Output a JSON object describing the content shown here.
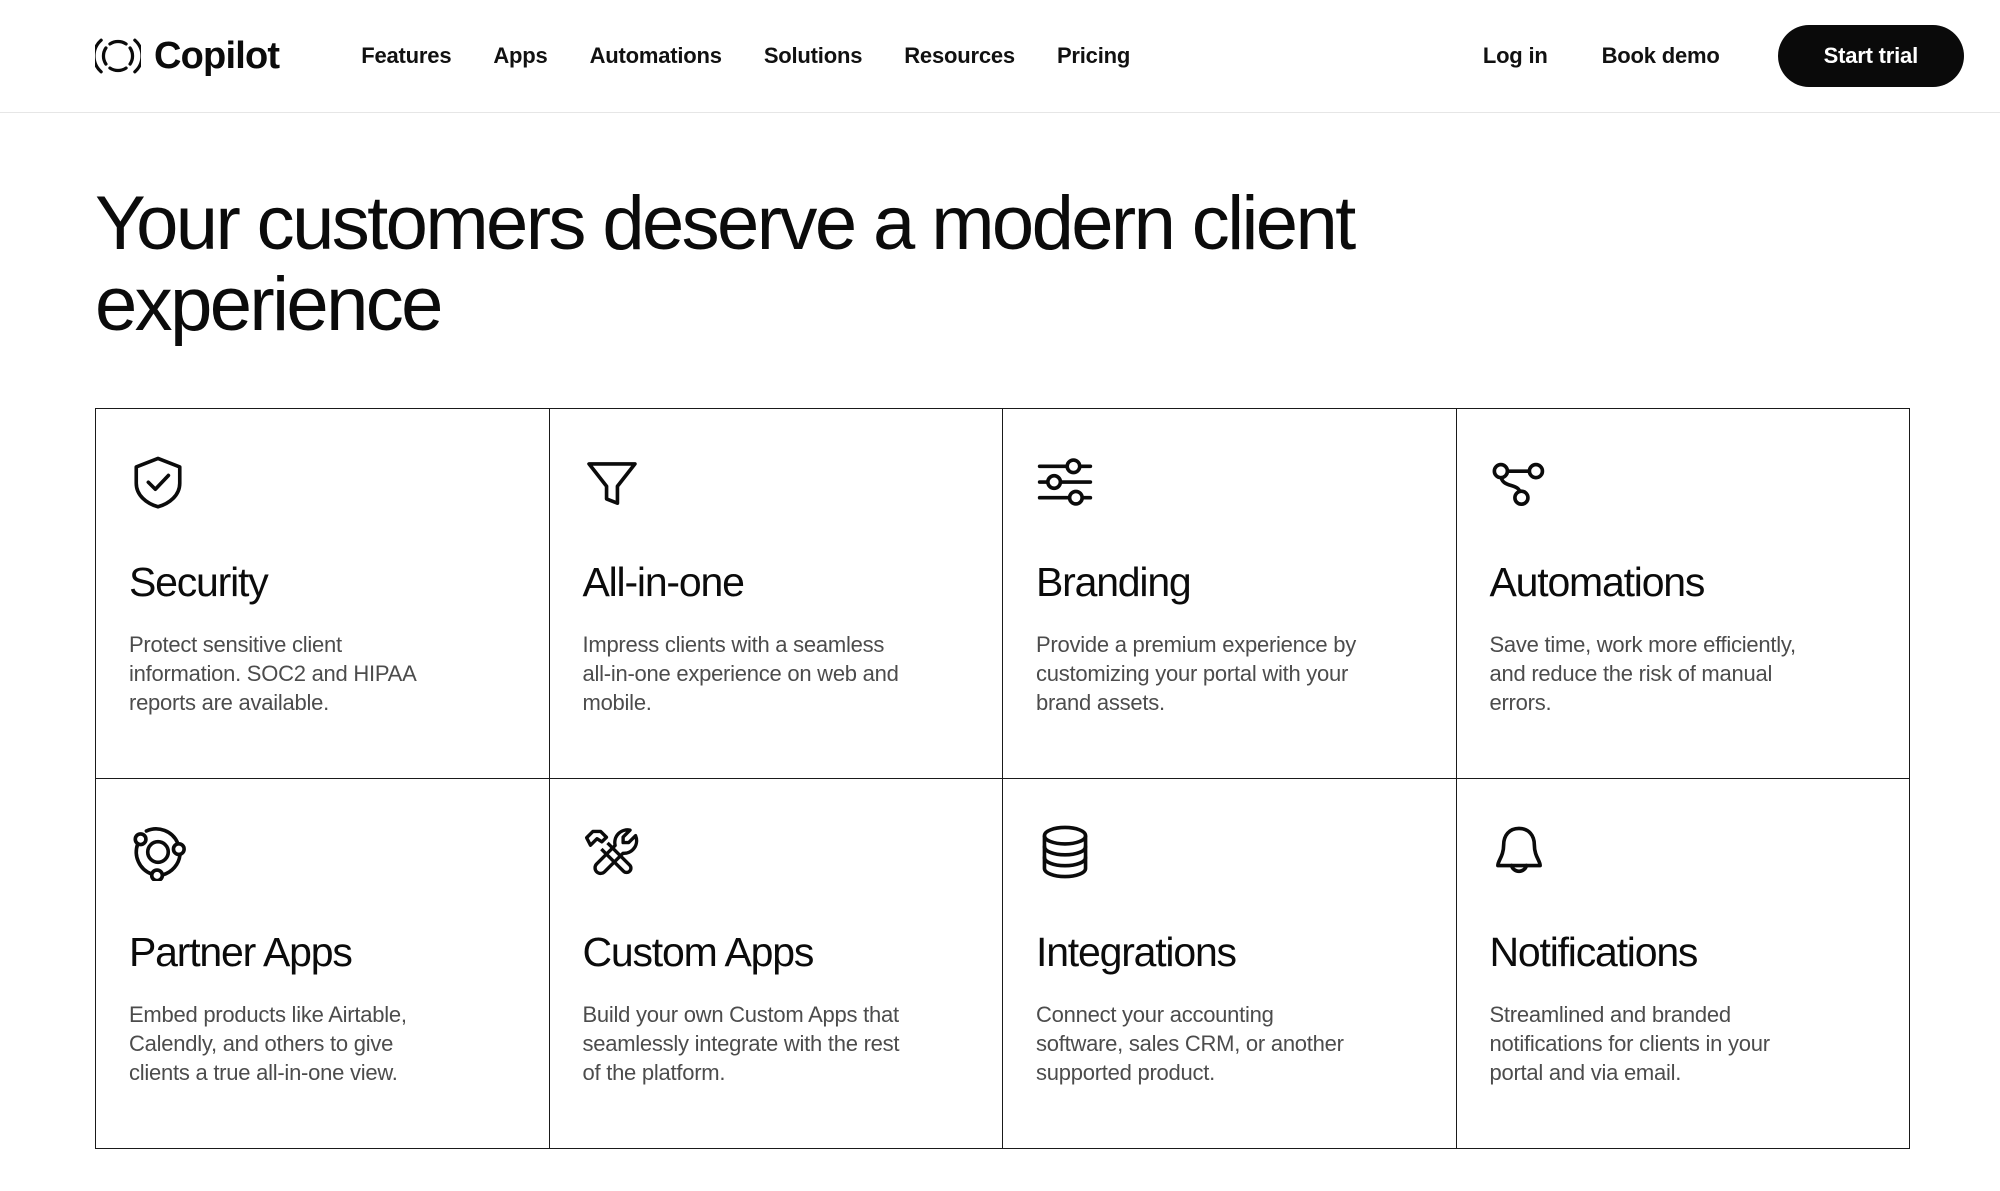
{
  "header": {
    "brand": {
      "name": "Copilot",
      "logo_icon": "copilot-logo-icon"
    },
    "nav": [
      {
        "label": "Features"
      },
      {
        "label": "Apps"
      },
      {
        "label": "Automations"
      },
      {
        "label": "Solutions"
      },
      {
        "label": "Resources"
      },
      {
        "label": "Pricing"
      }
    ],
    "actions": {
      "login_label": "Log in",
      "book_demo_label": "Book demo",
      "start_trial_label": "Start trial"
    },
    "colors": {
      "cta_background": "#0a0a0a",
      "cta_text": "#ffffff",
      "border": "#e6e6e6"
    }
  },
  "hero": {
    "title": "Your customers deserve a modern client experience"
  },
  "features": {
    "cards": [
      {
        "icon": "shield-check-icon",
        "title": "Security",
        "description": "Protect sensitive client information. SOC2 and HIPAA reports are available."
      },
      {
        "icon": "funnel-icon",
        "title": "All-in-one",
        "description": "Impress clients with a seamless all-in-one experience on web and mobile."
      },
      {
        "icon": "sliders-icon",
        "title": "Branding",
        "description": "Provide a premium experience by customizing your portal with your brand assets."
      },
      {
        "icon": "git-branch-icon",
        "title": "Automations",
        "description": "Save time, work more efficiently, and reduce the risk of manual errors."
      },
      {
        "icon": "orbit-icon",
        "title": "Partner Apps",
        "description": "Embed products like Airtable, Calendly, and others to give clients a true all-in-one view."
      },
      {
        "icon": "hammer-wrench-icon",
        "title": "Custom Apps",
        "description": "Build your own Custom Apps that seamlessly integrate with the rest of the platform."
      },
      {
        "icon": "database-icon",
        "title": "Integrations",
        "description": "Connect your accounting software, sales CRM, or another supported product."
      },
      {
        "icon": "bell-icon",
        "title": "Notifications",
        "description": "Streamlined and branded notifications for clients in your portal and via email."
      }
    ]
  },
  "colors": {
    "page_background": "#ffffff",
    "text_primary": "#0b0b0b",
    "text_secondary": "#4c4c4c",
    "grid_border": "#1a1a1a"
  }
}
